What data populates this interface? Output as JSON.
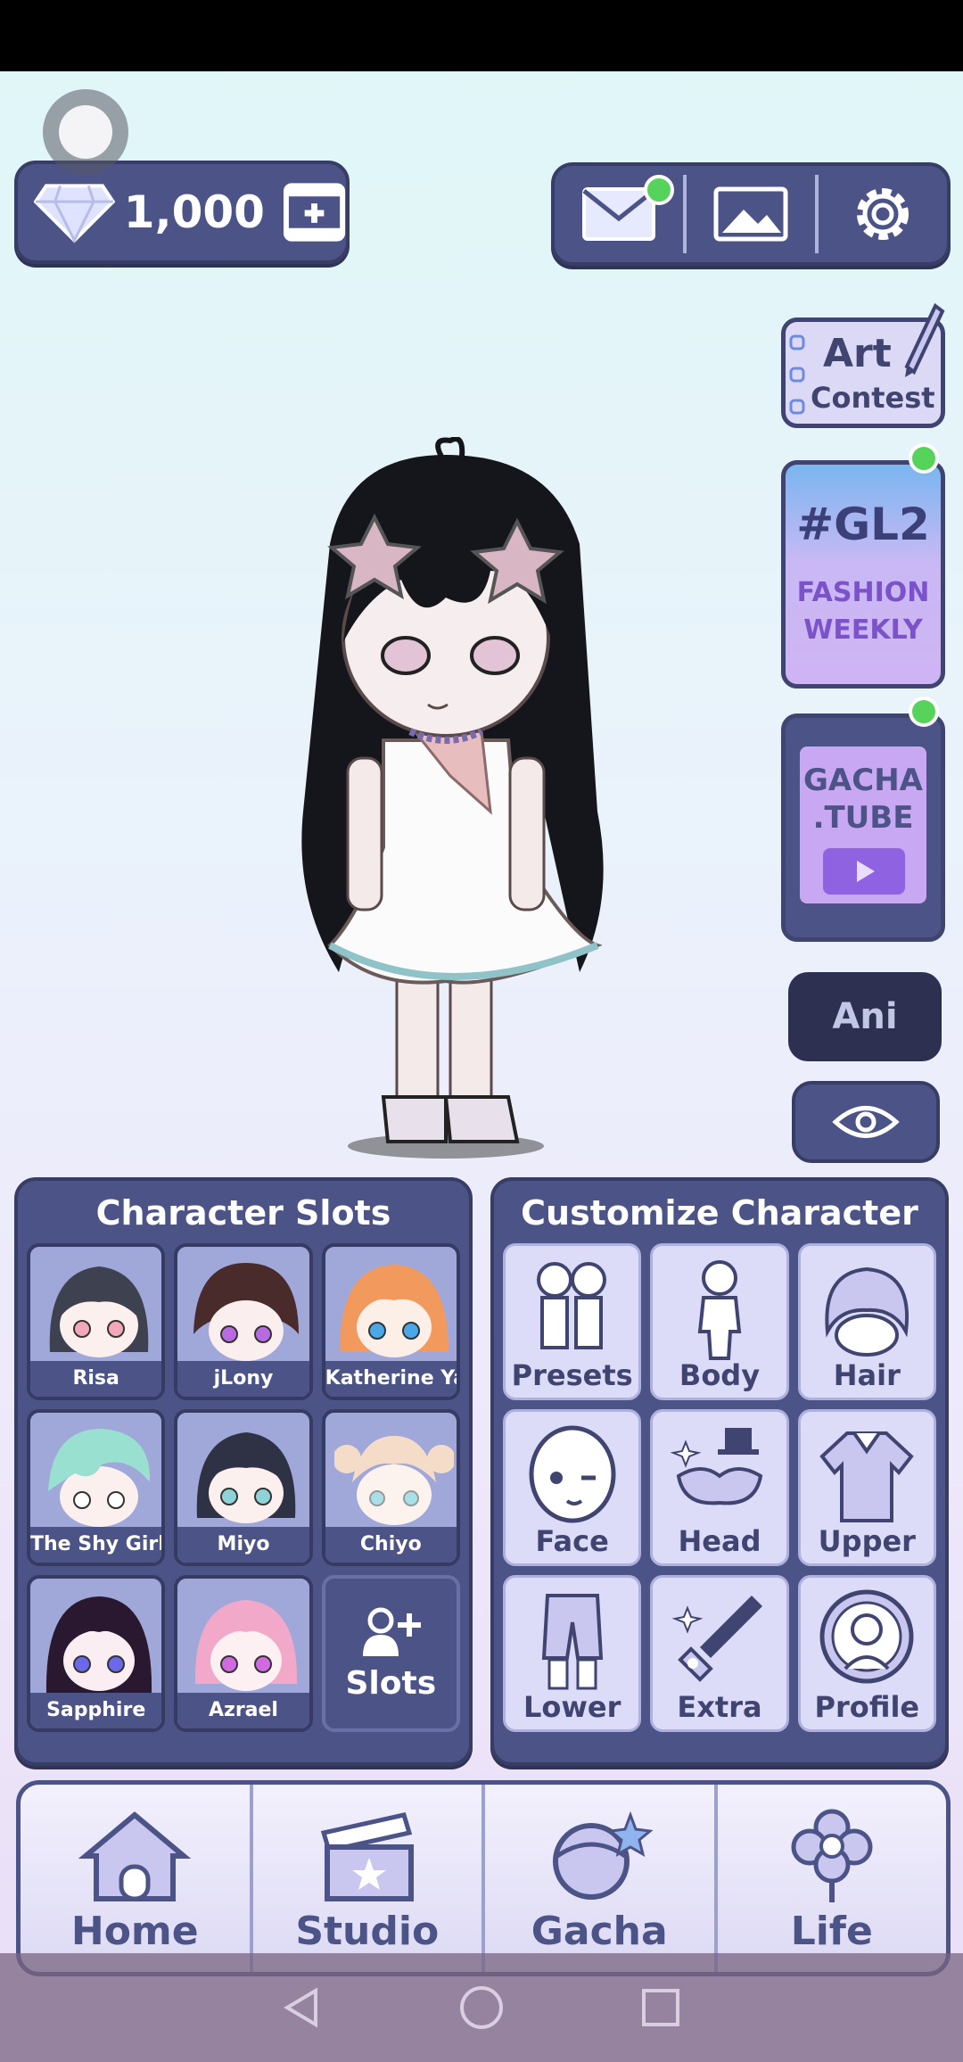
{
  "top": {
    "gems": "1,000"
  },
  "side": {
    "art_contest": [
      "Art",
      "Contest"
    ],
    "gl2": {
      "tag": "#GL2",
      "line1": "FASHION",
      "line2": "WEEKLY"
    },
    "gachatube": [
      "GACHA",
      ".TUBE"
    ],
    "ani": "Ani"
  },
  "slots": {
    "title": "Character Slots",
    "items": [
      {
        "name": "Risa"
      },
      {
        "name": "jLony"
      },
      {
        "name": "Katherine Yas"
      },
      {
        "name": "The Shy Girl"
      },
      {
        "name": "Miyo"
      },
      {
        "name": "Chiyo"
      },
      {
        "name": "Sapphire"
      },
      {
        "name": "Azrael"
      }
    ],
    "add_label": "Slots"
  },
  "customize": {
    "title": "Customize Character",
    "items": [
      "Presets",
      "Body",
      "Hair",
      "Face",
      "Head",
      "Upper",
      "Lower",
      "Extra",
      "Profile"
    ]
  },
  "nav": [
    "Home",
    "Studio",
    "Gacha",
    "Life"
  ],
  "colors": {
    "panel": "#4b5387",
    "panel_dark": "#383d66",
    "notif_green": "#56d35b",
    "tile": "#dcdcf8"
  }
}
